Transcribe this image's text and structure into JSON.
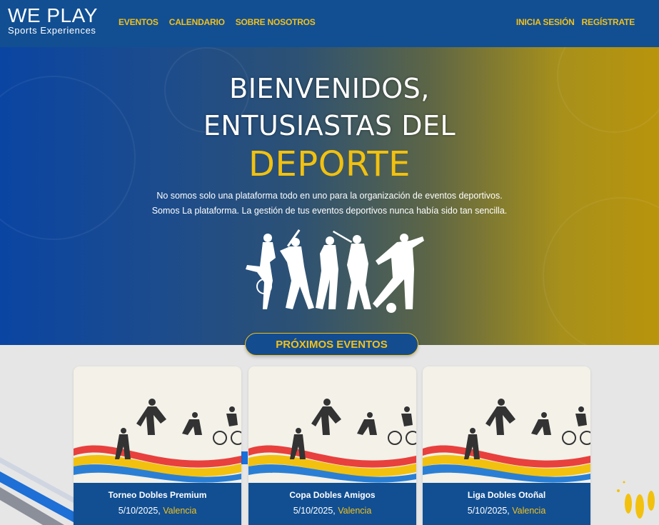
{
  "brand": {
    "name": "WE PLAY",
    "tagline": "Sports Experiences"
  },
  "nav": {
    "links": [
      {
        "label": "EVENTOS"
      },
      {
        "label": "CALENDARIO"
      },
      {
        "label": "SOBRE NOSOTROS"
      }
    ],
    "login": "INICIA SESIÓN",
    "register": "REGÍSTRATE"
  },
  "hero": {
    "title_line1": "BIENVENIDOS,",
    "title_line2": "ENTUSIASTAS DEL",
    "title_accent": "DEPORTE",
    "text_line1": "No somos solo una plataforma todo en uno para la organización de eventos deportivos.",
    "text_line2": "Somos La plataforma. La gestión de tus eventos deportivos nunca había sido tan sencilla."
  },
  "section": {
    "title": "PRÓXIMOS EVENTOS"
  },
  "events": [
    {
      "title": "Torneo Dobles Premium",
      "date": "5/10/2025,",
      "city": "Valencia"
    },
    {
      "title": "Copa Dobles Amigos",
      "date": "5/10/2025,",
      "city": "Valencia"
    },
    {
      "title": "Liga Dobles Otoñal",
      "date": "5/10/2025,",
      "city": "Valencia"
    }
  ],
  "colors": {
    "primary": "#124f92",
    "accent": "#f3c01a"
  }
}
